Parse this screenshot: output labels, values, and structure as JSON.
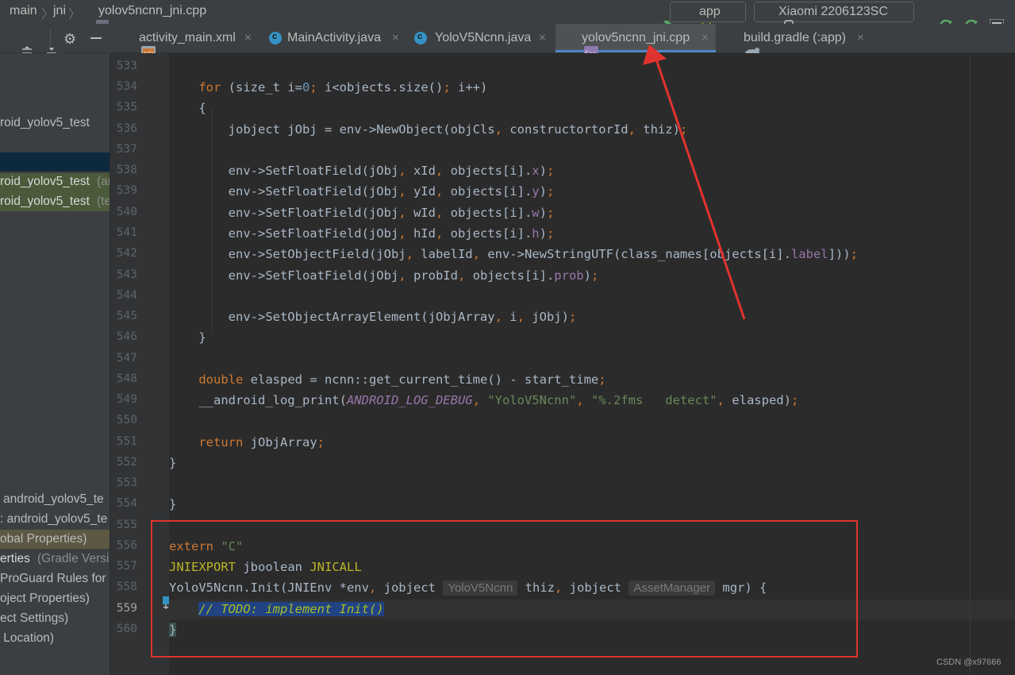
{
  "nav": {
    "breadcrumb": [
      "main",
      "jni",
      "yolov5ncnn_jni.cpp"
    ],
    "run_config": "app",
    "device": "Xiaomi 2206123SC"
  },
  "tabs": [
    {
      "label": "activity_main.xml",
      "close": "×",
      "icon": "xml-layout-icon"
    },
    {
      "label": "MainActivity.java",
      "close": "×",
      "icon": "java-class-icon"
    },
    {
      "label": "YoloV5Ncnn.java",
      "close": "×",
      "icon": "java-class-icon"
    },
    {
      "label": "yolov5ncnn_jni.cpp",
      "close": "×",
      "icon": "cpp-file-icon",
      "active": true
    },
    {
      "label": "build.gradle (:app)",
      "close": "×",
      "icon": "gradle-icon"
    }
  ],
  "left_panel": {
    "items": [
      "roid_yolov5_test",
      "roid_yolov5_test",
      "(an",
      "roid_yolov5_test",
      "(te",
      "android_yolov5_te",
      ": android_yolov5_te",
      "obal Properties)",
      "erties",
      "(Gradle Versi",
      "ProGuard Rules for a",
      "oject Properties)",
      "ect Settings)",
      " Location)"
    ]
  },
  "editor": {
    "line_numbers": [
      "533",
      "534",
      "535",
      "536",
      "537",
      "538",
      "539",
      "540",
      "541",
      "542",
      "543",
      "544",
      "545",
      "546",
      "547",
      "548",
      "549",
      "550",
      "551",
      "552",
      "553",
      "554",
      "555",
      "556",
      "557",
      "558",
      "559",
      "560"
    ],
    "current_line": "559",
    "hint_objcls": "YoloV5Ncnn",
    "hint_assetmgr": "AssetManager",
    "todo_comment": "// TODO: implement Init()"
  },
  "annotation": {
    "arrow_color": "#e0332f",
    "box_color": "#e0332f"
  },
  "watermark": "CSDN @x97666",
  "colors": {
    "keyword": "#cc7832",
    "number": "#6897bb",
    "string": "#6a8759",
    "field": "#9876aa",
    "macro": "#bbb529",
    "todo": "#a8c023",
    "selection": "#214283"
  }
}
